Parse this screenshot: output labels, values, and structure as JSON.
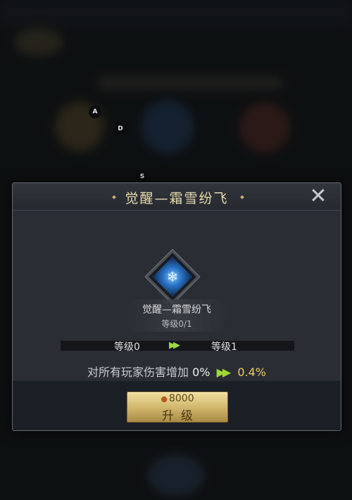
{
  "hints": {
    "a": "A",
    "d": "D",
    "s": "S"
  },
  "dialog": {
    "title": "觉醒—霜雪纷飞",
    "close_symbol": "✕",
    "skill": {
      "name": "觉醒—霜雪纷飞",
      "level": "等级0/1",
      "icon": "frost-skill-icon"
    },
    "level_from": "等级0",
    "level_to": "等级1",
    "effect": {
      "label": "对所有玩家伤害增加",
      "current": "0%",
      "next": "0.4%"
    },
    "upgrade": {
      "cost": "8000",
      "label": "升级"
    }
  },
  "colors": {
    "accent_green": "#9ed93a",
    "next_value": "#e9cc5f",
    "title": "#e9d9ad"
  }
}
